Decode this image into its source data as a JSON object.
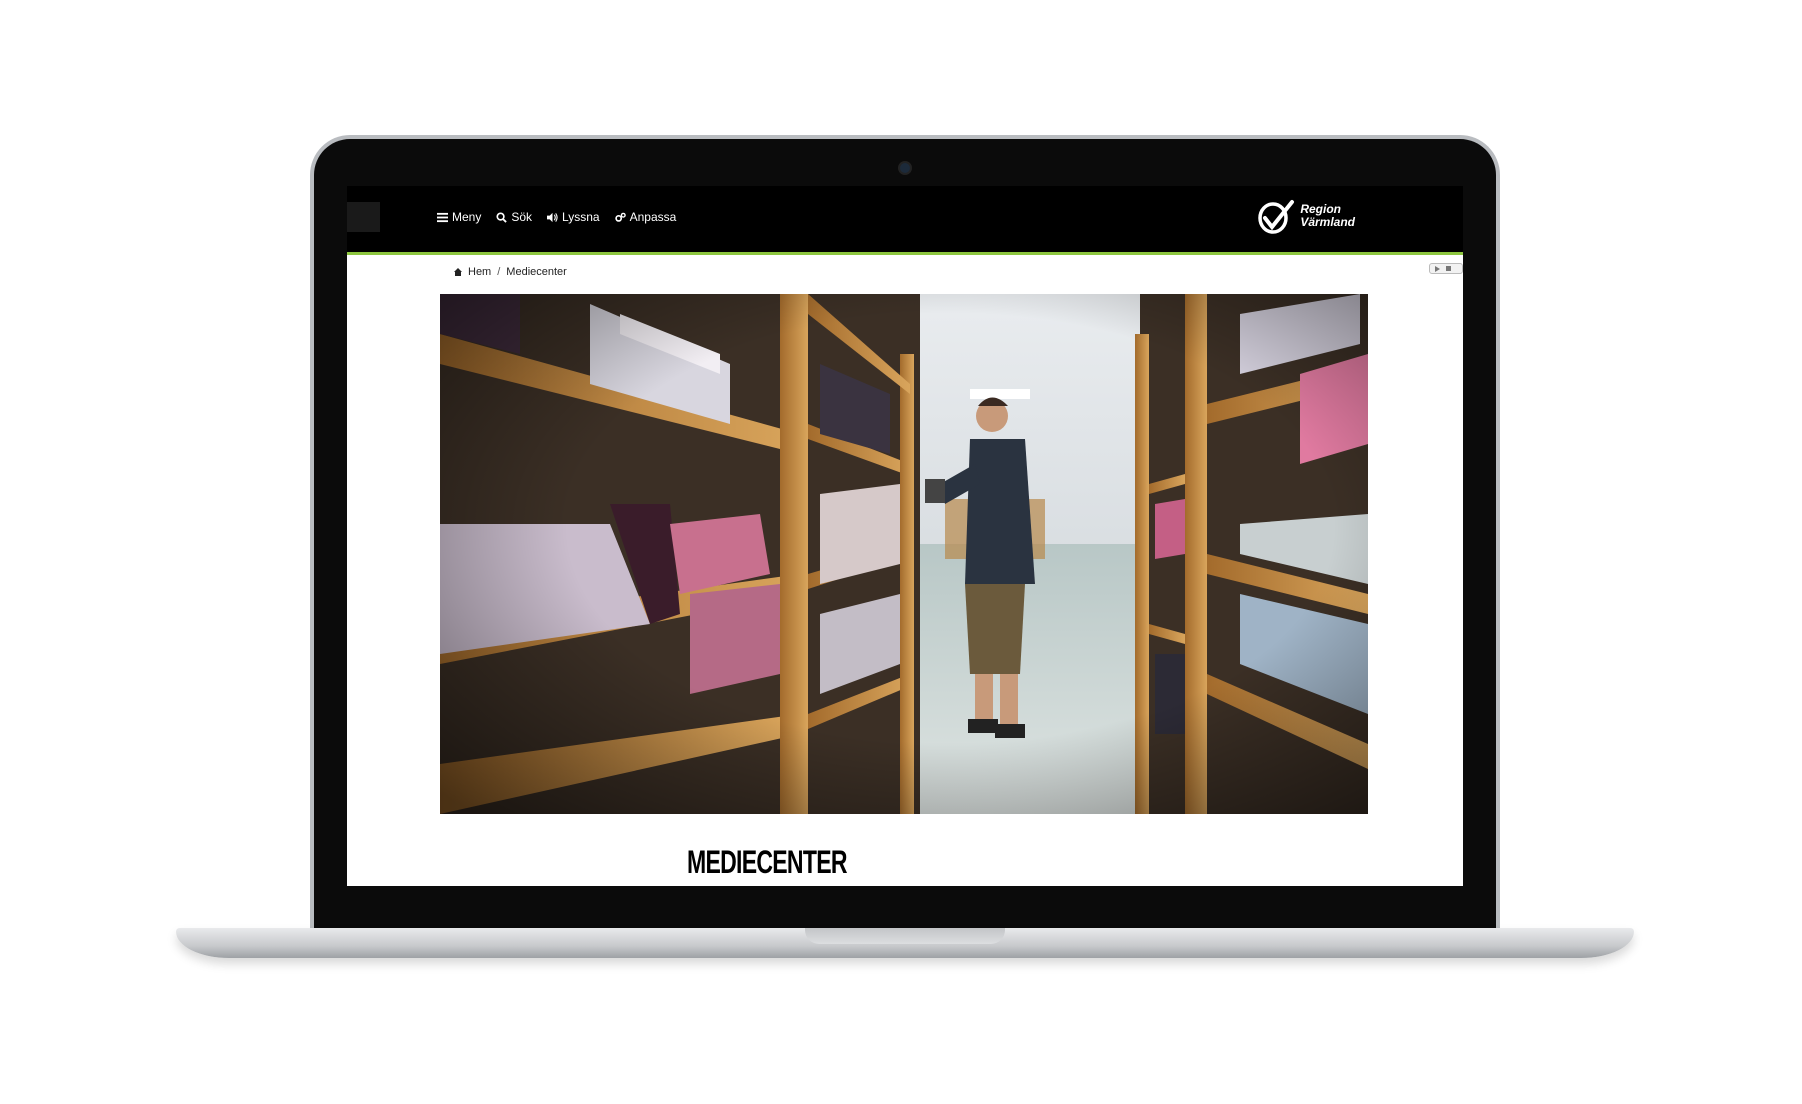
{
  "nav": {
    "items": [
      {
        "label": "Meny",
        "icon": "menu-icon"
      },
      {
        "label": "Sök",
        "icon": "search-icon"
      },
      {
        "label": "Lyssna",
        "icon": "speaker-icon"
      },
      {
        "label": "Anpassa",
        "icon": "gears-icon"
      }
    ],
    "logo_line1": "Region",
    "logo_line2": "Värmland"
  },
  "breadcrumb": {
    "home": "Hem",
    "separator": "/",
    "current": "Mediecenter"
  },
  "page": {
    "title": "MEDIECENTER"
  },
  "colors": {
    "accent": "#8dc63f",
    "navbar": "#000000"
  }
}
